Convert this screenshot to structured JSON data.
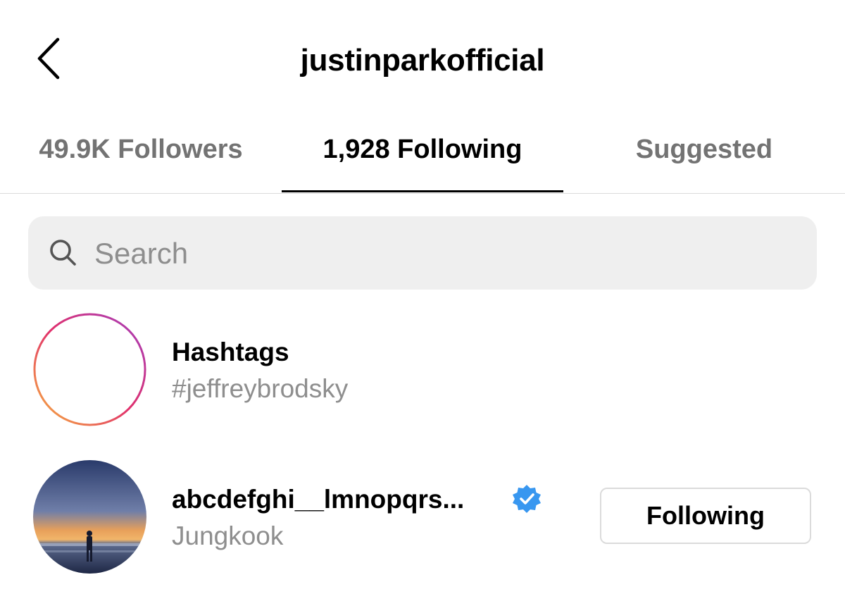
{
  "header": {
    "title": "justinparkofficial",
    "back_icon": "chevron-left-icon"
  },
  "tabs": [
    {
      "label": "49.9K Followers",
      "active": false
    },
    {
      "label": "1,928 Following",
      "active": true
    },
    {
      "label": "Suggested",
      "active": false
    }
  ],
  "search": {
    "placeholder": "Search",
    "value": "",
    "icon": "search-icon"
  },
  "list": [
    {
      "title": "Hashtags",
      "subtitle": "#jeffreybrodsky",
      "avatar_icon": "hashtag-icon"
    },
    {
      "username": "abcdefghi__lmnopqrs...",
      "verified": true,
      "display_name": "Jungkook",
      "button_label": "Following"
    }
  ],
  "colors": {
    "active_text": "#000000",
    "inactive_text": "#737373",
    "secondary_text": "#8e8e8e",
    "search_bg": "#efefef",
    "verified_blue": "#3897f0",
    "border": "#dbdbdb"
  }
}
